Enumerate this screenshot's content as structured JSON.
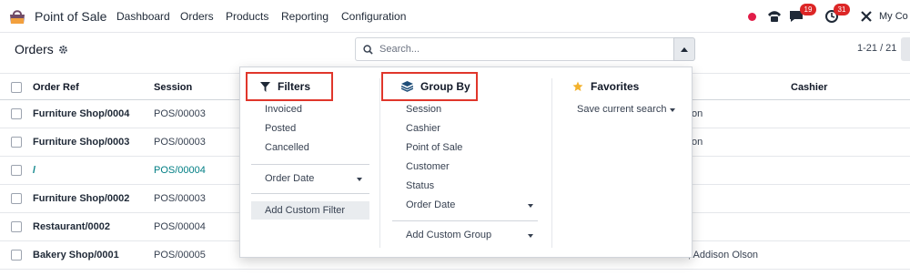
{
  "navbar": {
    "app_name": "Point of Sale",
    "menu": [
      "Dashboard",
      "Orders",
      "Products",
      "Reporting",
      "Configuration"
    ],
    "messages_badge": "19",
    "activities_badge": "31",
    "company": "My Co"
  },
  "control_panel": {
    "title": "Orders",
    "search_placeholder": "Search...",
    "pager": "1-21 / 21"
  },
  "list": {
    "headers": {
      "order_ref": "Order Ref",
      "session": "Session",
      "cashier": "Cashier"
    },
    "rows": [
      {
        "ref": "Furniture Shop/0004",
        "session": "POS/00003",
        "cashier_fragment": "on"
      },
      {
        "ref": "Furniture Shop/0003",
        "session": "POS/00003",
        "cashier_fragment": "on"
      },
      {
        "ref": "/",
        "session": "POS/00004",
        "cashier_fragment": ""
      },
      {
        "ref": "Furniture Shop/0002",
        "session": "POS/00003",
        "cashier_fragment": ""
      },
      {
        "ref": "Restaurant/0002",
        "session": "POS/00004",
        "cashier_fragment": ""
      },
      {
        "ref": "Bakery Shop/0001",
        "session": "POS/00005",
        "cashier_fragment": ", Addison Olson"
      }
    ]
  },
  "search_panel": {
    "filters": {
      "title": "Filters",
      "options": [
        "Invoiced",
        "Posted",
        "Cancelled"
      ],
      "order_date": "Order Date",
      "add_custom": "Add Custom Filter"
    },
    "group_by": {
      "title": "Group By",
      "options": [
        "Session",
        "Cashier",
        "Point of Sale",
        "Customer",
        "Status"
      ],
      "order_date": "Order Date",
      "add_custom": "Add Custom Group"
    },
    "favorites": {
      "title": "Favorites",
      "save_current": "Save current search"
    }
  },
  "colors": {
    "highlight": "#e0362b",
    "link": "#017e84",
    "badge": "#dc2626",
    "favorite_star": "#f3b22d"
  }
}
